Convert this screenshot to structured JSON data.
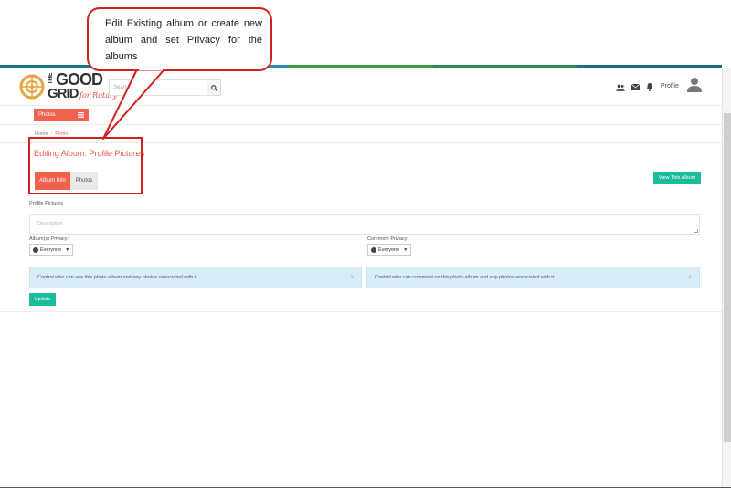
{
  "annotation": {
    "text": "Edit Existing album or create new album and set Privacy for the albums"
  },
  "stripe_colors": [
    "#17758a",
    "#2b8bb5",
    "#3c9a3a",
    "#2a8a55",
    "#1e6b8c"
  ],
  "header": {
    "logo": {
      "line1": "THE",
      "line2": "GOOD",
      "line3": "GRID",
      "tagline": "for Rotary"
    },
    "search_placeholder": "Search...",
    "profile_label": "Profile"
  },
  "nav": {
    "photos_button": "Photos"
  },
  "breadcrumb": {
    "home": "Home",
    "current": "Photo"
  },
  "page": {
    "title": "Editing Album: Profile Pictures"
  },
  "tabs": {
    "album_info": "Album Info",
    "photos": "Photos",
    "view_button": "View This Album"
  },
  "form": {
    "album_name": "Profile Pictures",
    "description_placeholder": "Description",
    "album_privacy_label": "Album(s) Privacy:",
    "album_privacy_value": "Everyone",
    "comment_privacy_label": "Comment Privacy:",
    "comment_privacy_value": "Everyone",
    "album_privacy_help": "Control who can see this photo album and any photos associated with it.",
    "comment_privacy_help": "Control who can comment on this photo album and any photos associated with it.",
    "update_button": "Update"
  },
  "colors": {
    "accent": "#f0624d",
    "teal": "#1abc9c",
    "info_bg": "#d9edf7",
    "annotation_red": "#d02020"
  }
}
